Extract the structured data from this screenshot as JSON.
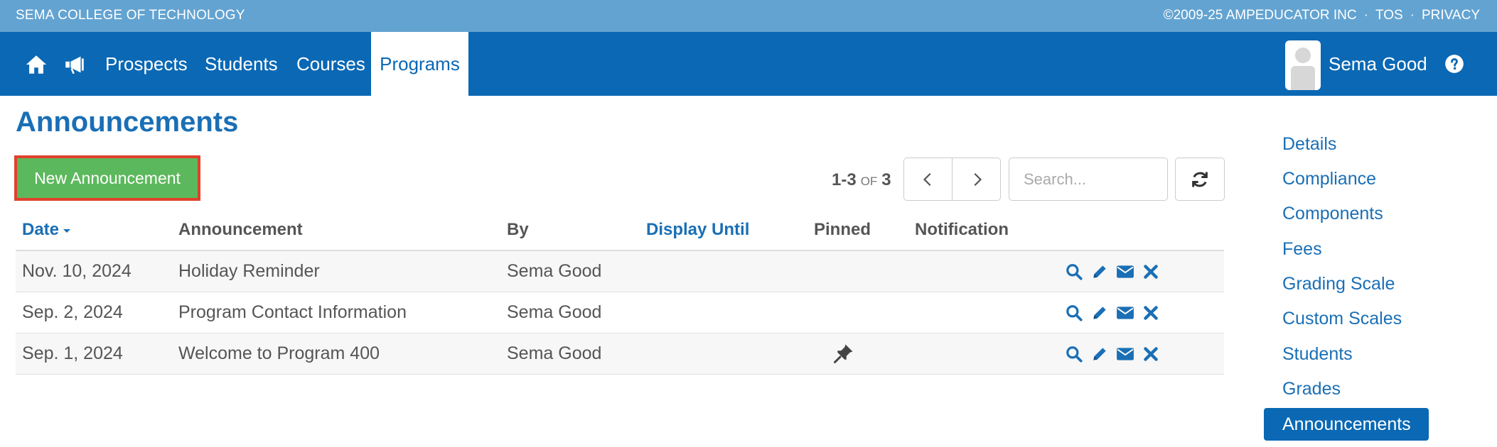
{
  "topbar": {
    "school": "SEMA COLLEGE OF TECHNOLOGY",
    "copyright": "©2009-25 AMPEDUCATOR INC",
    "sep": "·",
    "tos": "TOS",
    "privacy": "PRIVACY"
  },
  "nav": {
    "items": [
      {
        "label": "Prospects"
      },
      {
        "label": "Students"
      },
      {
        "label": "Courses"
      },
      {
        "label": "Programs"
      }
    ],
    "active_item": "Programs",
    "user_name": "Sema Good",
    "icons": [
      "home-icon",
      "megaphone-icon",
      "question-circle-icon"
    ]
  },
  "page": {
    "title": "Announcements",
    "new_button": "New Announcement",
    "pager": {
      "range": "1-3",
      "of": "OF",
      "total": "3"
    },
    "search_placeholder": "Search..."
  },
  "table": {
    "columns": [
      "Date",
      "Announcement",
      "By",
      "Display Until",
      "Pinned",
      "Notification"
    ],
    "sort_column": "Date",
    "rows": [
      {
        "date": "Nov. 10, 2024",
        "announcement": "Holiday Reminder",
        "by": "Sema Good",
        "display_until": "",
        "pinned": false,
        "notification": ""
      },
      {
        "date": "Sep. 2, 2024",
        "announcement": "Program Contact Information",
        "by": "Sema Good",
        "display_until": "",
        "pinned": false,
        "notification": ""
      },
      {
        "date": "Sep. 1, 2024",
        "announcement": "Welcome to Program 400",
        "by": "Sema Good",
        "display_until": "",
        "pinned": true,
        "notification": ""
      }
    ],
    "row_actions": [
      "view-icon",
      "edit-icon",
      "email-icon",
      "delete-icon"
    ]
  },
  "sidebar": {
    "items": [
      {
        "label": "Details"
      },
      {
        "label": "Compliance"
      },
      {
        "label": "Components"
      },
      {
        "label": "Fees"
      },
      {
        "label": "Grading Scale"
      },
      {
        "label": "Custom Scales"
      },
      {
        "label": "Students"
      },
      {
        "label": "Grades"
      },
      {
        "label": "Announcements"
      }
    ],
    "active_item": "Announcements"
  },
  "colors": {
    "topbar": "#63a3d1",
    "navbar": "#0a68b4",
    "link": "#1a6fb5",
    "button_green": "#5cb85c",
    "highlight_border": "#e0412c"
  }
}
